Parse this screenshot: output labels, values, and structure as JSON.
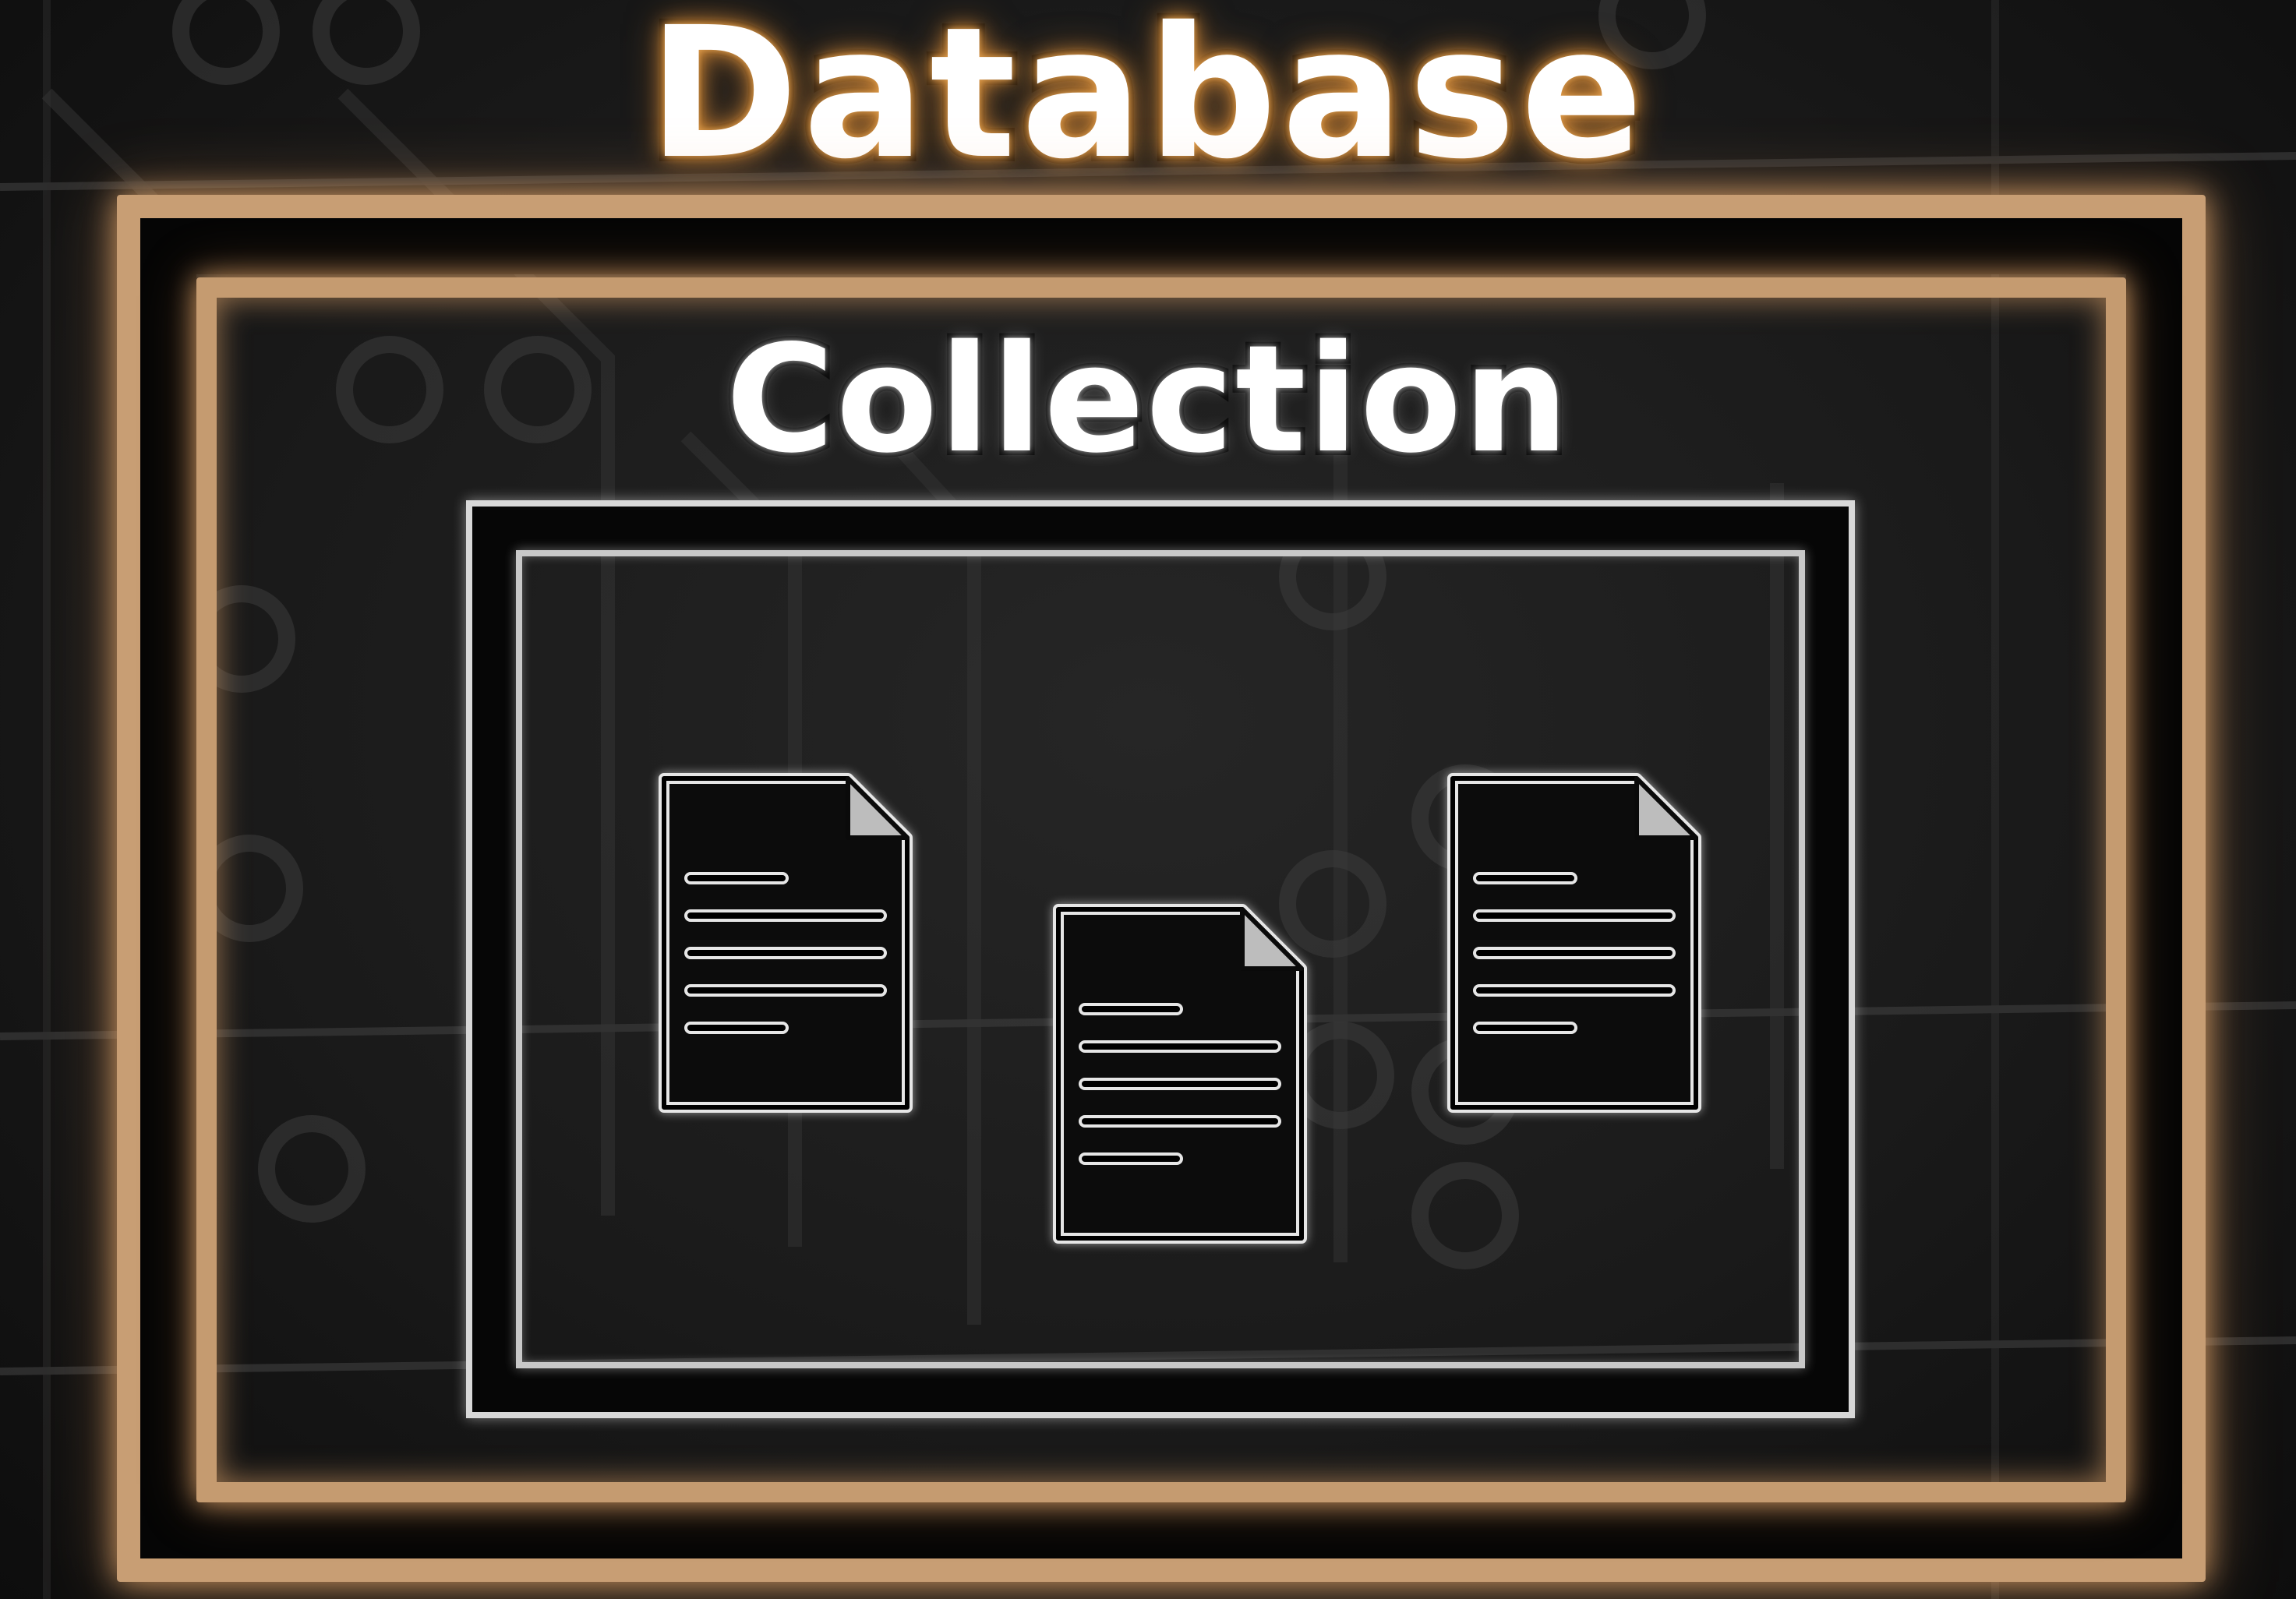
{
  "titles": {
    "database": "Database",
    "collection": "Collection"
  },
  "colors": {
    "database_accent": "#c89e74",
    "collection_accent": "#c59b70",
    "document_outline": "#d8d8d8",
    "background": "#1a1a1a"
  },
  "documents": [
    {
      "icon": "document-icon"
    },
    {
      "icon": "document-icon"
    },
    {
      "icon": "document-icon"
    }
  ]
}
